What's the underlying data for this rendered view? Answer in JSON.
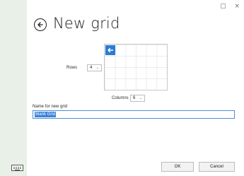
{
  "window": {
    "minimize_glyph": "▢",
    "close_glyph": "×"
  },
  "header": {
    "title": "New grid",
    "back_icon": "arrow-left-circle-icon"
  },
  "grid": {
    "rows_label": "Rows",
    "rows_value": "4",
    "columns_label": "Columns",
    "columns_value": "6",
    "preview_rows": 4,
    "preview_columns": 6,
    "accent": "#2b7cd3"
  },
  "name": {
    "label": "Name for new grid",
    "value": "Blank Grid"
  },
  "footer": {
    "ok_label": "OK",
    "cancel_label": "Cancel",
    "keyboard_icon": "keyboard-icon"
  }
}
